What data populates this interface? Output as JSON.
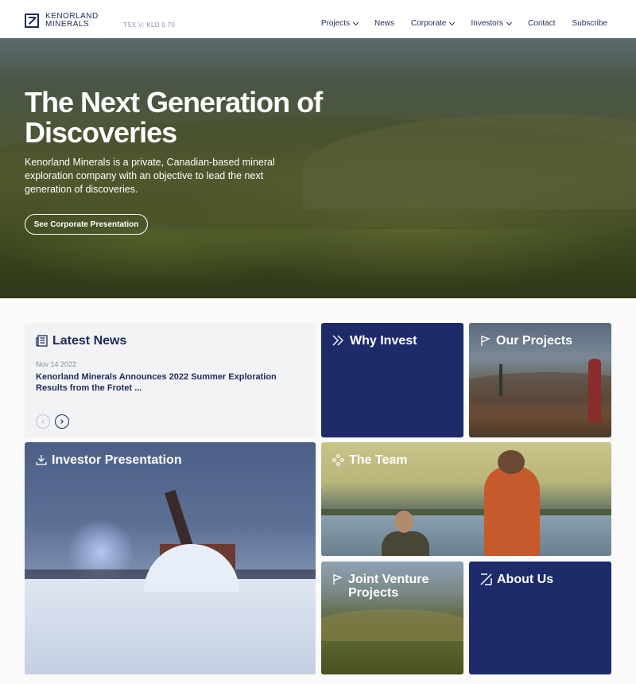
{
  "header": {
    "logo_line1": "KENORLAND",
    "logo_line2": "MINERALS",
    "ticker": "TSX.V: KLD 0.70",
    "nav": [
      {
        "label": "Projects",
        "has_dropdown": true
      },
      {
        "label": "News",
        "has_dropdown": false
      },
      {
        "label": "Corporate",
        "has_dropdown": true
      },
      {
        "label": "Investors",
        "has_dropdown": true
      },
      {
        "label": "Contact",
        "has_dropdown": false
      },
      {
        "label": "Subscribe",
        "has_dropdown": false
      }
    ]
  },
  "hero": {
    "title": "The Next Generation of Discoveries",
    "description": "Kenorland Minerals is a private, Canadian-based mineral exploration company with an objective to lead the next generation of discoveries.",
    "cta_label": "See Corporate Presentation"
  },
  "news": {
    "title": "Latest News",
    "date": "Nov 14 2022",
    "headline": "Kenorland Minerals Announces 2022 Summer Exploration Results from the Frotet ..."
  },
  "tiles": {
    "why_invest": "Why Invest",
    "our_projects": "Our Projects",
    "investor_presentation": "Investor Presentation",
    "the_team": "The Team",
    "joint_venture": "Joint Venture Projects",
    "about_us": "About Us"
  },
  "colors": {
    "brand_navy": "#1e2b6a",
    "text_navy": "#1e2a5e",
    "news_bg": "#f2f3f4"
  },
  "icons": [
    "logo-icon",
    "chevron-down-icon",
    "newspaper-icon",
    "double-chevron-icon",
    "flag-icon",
    "download-icon",
    "people-nodes-icon",
    "logo-mark-icon",
    "arrow-left-icon",
    "arrow-right-icon"
  ]
}
